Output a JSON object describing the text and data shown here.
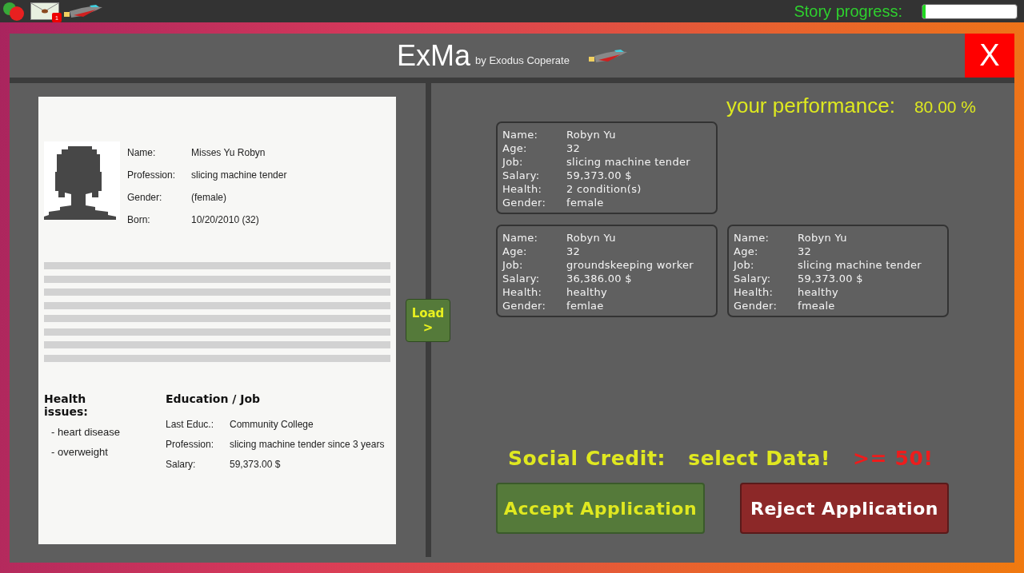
{
  "top_bar": {
    "notification_count": "1",
    "story_progress": {
      "label": "Story progress:",
      "level": 0.03
    }
  },
  "window": {
    "title": "ExMa",
    "subtitle": "by Exodus Coperate",
    "close_label": "X"
  },
  "document": {
    "fields": [
      {
        "label": "Name:",
        "value": "Misses Yu Robyn"
      },
      {
        "label": "Profession:",
        "value": "slicing machine tender"
      },
      {
        "label": "Gender:",
        "value": "(female)"
      },
      {
        "label": "Born:",
        "value": "10/20/2010 (32)"
      }
    ],
    "health": {
      "title": "Health issues:",
      "items": [
        "- heart disease",
        "- overweight"
      ]
    },
    "education": {
      "title": "Education / Job",
      "fields": [
        {
          "label": "Last Educ.:",
          "value": "Community College"
        },
        {
          "label": "Profession:",
          "value": "slicing machine tender since 3 years"
        },
        {
          "label": "Salary:",
          "value": "59,373.00 $"
        }
      ]
    }
  },
  "load_button": {
    "lines": [
      "Load",
      ">"
    ]
  },
  "performance": {
    "label": "your performance:",
    "value": "80.00 %"
  },
  "records": [
    {
      "rows": [
        {
          "label": "Name:",
          "value": "Robyn Yu"
        },
        {
          "label": "Age:",
          "value": "32"
        },
        {
          "label": "Job:",
          "value": "slicing machine tender"
        },
        {
          "label": "Salary:",
          "value": "59,373.00 $"
        },
        {
          "label": "Health:",
          "value": "2 condition(s)"
        },
        {
          "label": "Gender:",
          "value": "female"
        }
      ]
    },
    {
      "rows": [
        {
          "label": "Name:",
          "value": "Robyn Yu"
        },
        {
          "label": "Age:",
          "value": "32"
        },
        {
          "label": "Job:",
          "value": "groundskeeping worker"
        },
        {
          "label": "Salary:",
          "value": "36,386.00 $"
        },
        {
          "label": "Health:",
          "value": "healthy"
        },
        {
          "label": "Gender:",
          "value": "femlae"
        }
      ]
    },
    {
      "rows": [
        {
          "label": "Name:",
          "value": "Robyn Yu"
        },
        {
          "label": "Age:",
          "value": "32"
        },
        {
          "label": "Job:",
          "value": "slicing machine tender"
        },
        {
          "label": "Salary:",
          "value": "59,373.00 $"
        },
        {
          "label": "Health:",
          "value": "healthy"
        },
        {
          "label": "Gender:",
          "value": "fmeale"
        }
      ]
    }
  ],
  "social_credit": {
    "label": "Social Credit:",
    "value": "select Data!",
    "threshold": ">= 50!"
  },
  "actions": [
    {
      "kind": "accept",
      "label": "Accept Application"
    },
    {
      "kind": "reject",
      "label": "Reject Application"
    }
  ]
}
